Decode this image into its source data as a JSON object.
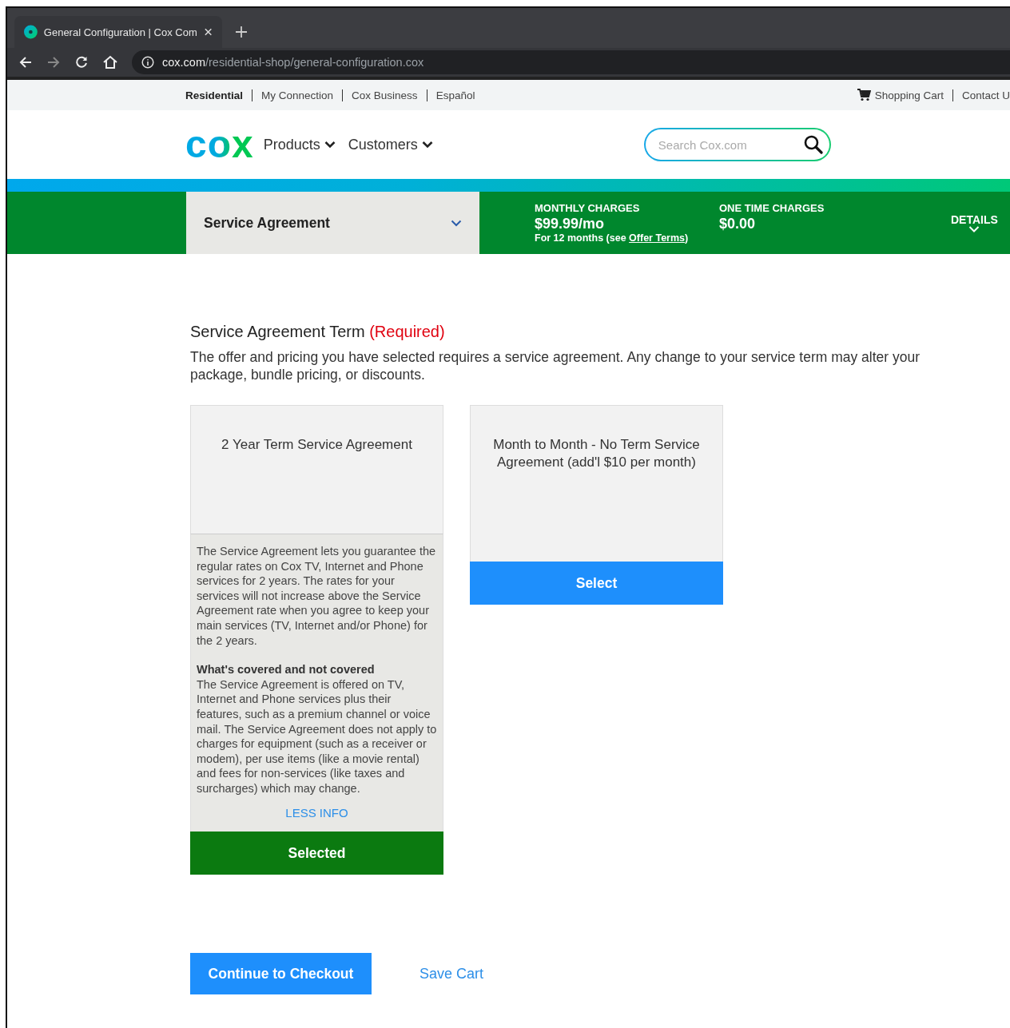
{
  "browser": {
    "tab_title": "General Configuration | Cox Com",
    "url_domain": "cox.com",
    "url_path": "/residential-shop/general-configuration.cox"
  },
  "utility_nav": {
    "items": [
      {
        "label": "Residential",
        "selected": true
      },
      {
        "label": "My Connection",
        "selected": false
      },
      {
        "label": "Cox Business",
        "selected": false
      },
      {
        "label": "Español",
        "selected": false
      }
    ],
    "right_links": [
      "Shopping Cart",
      "Contact U"
    ]
  },
  "header": {
    "logo": "cox",
    "nav": [
      "Products",
      "Customers"
    ],
    "search": {
      "placeholder": "Search Cox.com"
    }
  },
  "order_bar": {
    "section": "Service Agreement",
    "monthly_label": "MONTHLY CHARGES",
    "monthly_value": "$99.99/mo",
    "monthly_note": "For 12 months (see ",
    "monthly_link": "Offer Terms",
    "monthly_note_end": ")",
    "one_time_label": "ONE TIME CHARGES",
    "one_time_value": "$0.00",
    "details": "DETAILS"
  },
  "content": {
    "heading": "Service Agreement Term",
    "required": "(Required)",
    "description": "The offer and pricing you have selected requires a service agreement. Any change to your service term may alter your package, bundle pricing, or discounts."
  },
  "options": [
    {
      "title": "2 Year Term Service Agreement",
      "selected": true,
      "expanded": true,
      "info": "The Service Agreement lets you guarantee the regular rates on Cox TV, Internet and Phone services for 2 years. The rates for your services will not increase above the Service Agreement rate when you agree to keep your main services (TV, Internet and/or Phone) for the 2 years.",
      "covered_heading": "What's covered and not covered",
      "covered_text": "The Service Agreement is offered on TV, Internet and Phone services plus their features, such as a premium channel or voice mail. The Service Agreement does not apply to charges for equipment (such as a receiver or modem), per use items (like a movie rental) and fees for non-services (like taxes and surcharges) which may change.",
      "less_info": "LESS INFO",
      "button": "Selected"
    },
    {
      "title": "Month to Month - No Term Service Agreement (add'l $10 per month)",
      "selected": false,
      "expanded": false,
      "button": "Select"
    }
  ],
  "actions": {
    "checkout": "Continue to Checkout",
    "save": "Save Cart"
  }
}
